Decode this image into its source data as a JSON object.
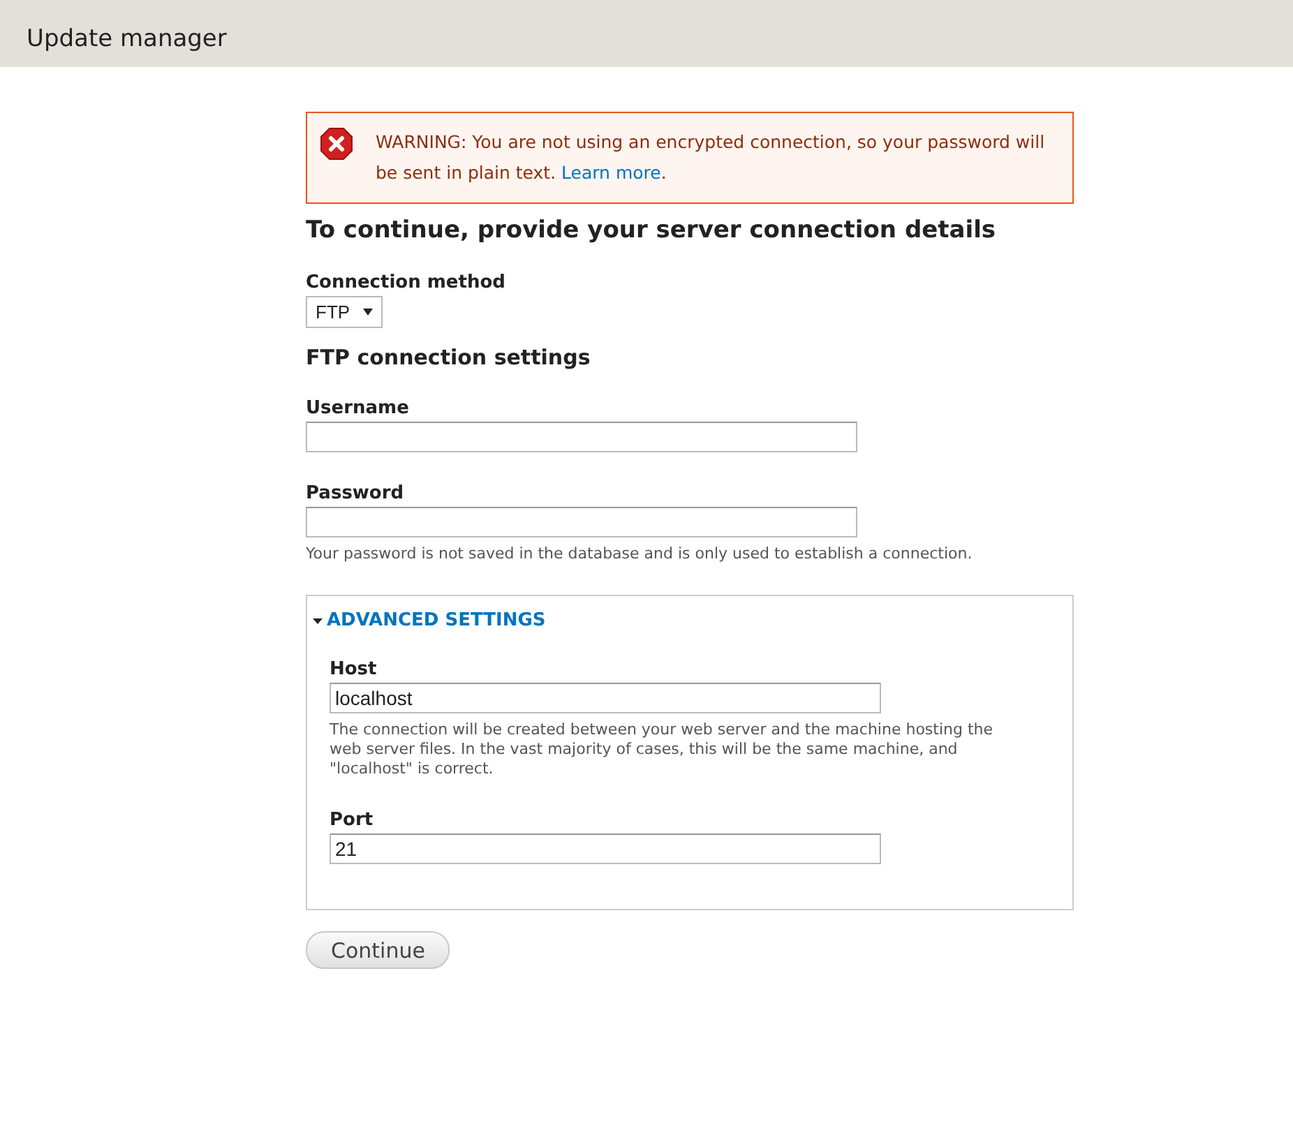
{
  "header": {
    "title": "Update manager"
  },
  "message": {
    "kind": "error",
    "text": "WARNING: You are not using an encrypted connection, so your password will be sent in plain text.",
    "link": "Learn more",
    "tail": "."
  },
  "heading": "To continue, provide your server connection details",
  "connection_method": {
    "label": "Connection method",
    "value": "FTP"
  },
  "settings_heading": "FTP connection settings",
  "fields": [
    {
      "label": "Username"
    },
    {
      "label": "Password",
      "description": "Your password is not saved in the database and is only used to establish a connection."
    }
  ],
  "advanced": {
    "title": "ADVANCED SETTINGS",
    "expanded": true,
    "fields": [
      {
        "label": "Host",
        "value": "localhost",
        "description": "The connection will be created between your web server and the machine hosting the web server files. In the vast majority of cases, this will be the same machine, and \"localhost\" is correct."
      },
      {
        "label": "Port",
        "value": "21"
      }
    ]
  },
  "submit": "Continue"
}
